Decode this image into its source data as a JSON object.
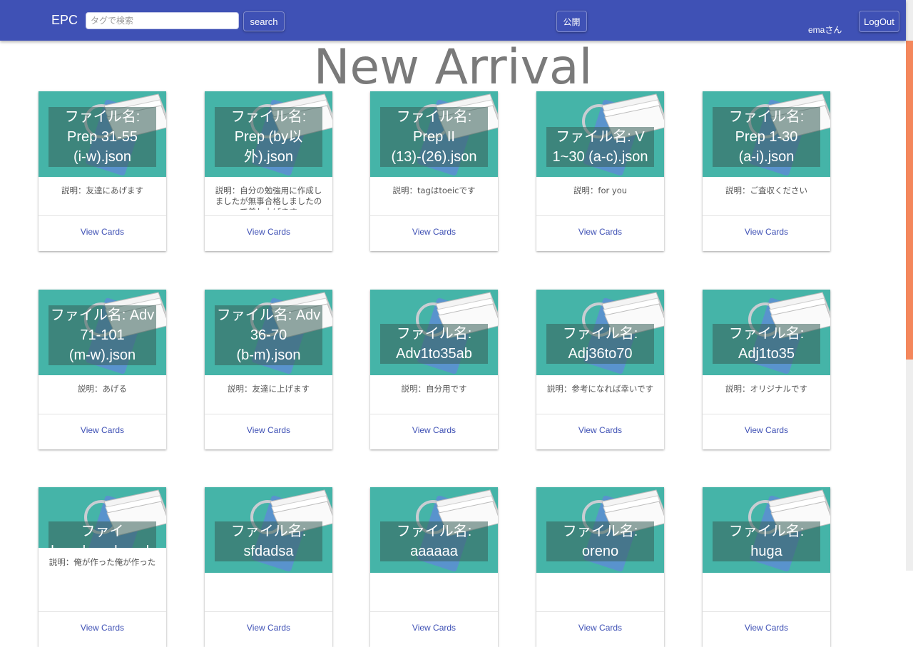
{
  "navbar": {
    "brand": "EPC",
    "search_placeholder": "タグで検索",
    "search_label": "search",
    "publish_label": "公開",
    "user_name": "emaさん",
    "logout_label": "LogOut",
    "bg_color": "#3f51b5"
  },
  "page_title": "New Arrival",
  "card_image_color": "#45b4a8",
  "card_icon": "flashcard-ring-icon",
  "cards": [
    {
      "title": [
        "ファイル名:",
        "Prep 31-55",
        "(i-w).json"
      ],
      "desc": "説明：友達にあげます",
      "action": "View Cards"
    },
    {
      "title": [
        "ファイル名:",
        "Prep (by以",
        "外).json"
      ],
      "desc": "説明：自分の勉強用に作成しましたが無事合格しましたので差し上げます",
      "action": "View Cards"
    },
    {
      "title": [
        "ファイル名:",
        "Prep II",
        "(13)-(26).json"
      ],
      "desc": "説明：tagはtoeicです",
      "action": "View Cards"
    },
    {
      "title": [
        "ファイル名: V",
        "1~30 (a-c).json"
      ],
      "desc": "説明：for you",
      "action": "View Cards"
    },
    {
      "title": [
        "ファイル名:",
        "Prep 1-30",
        "(a-i).json"
      ],
      "desc": "説明：ご査収ください",
      "action": "View Cards"
    },
    {
      "title": [
        "ファイル名: Adv",
        "71-101",
        "(m-w).json"
      ],
      "desc": "説明：あげる",
      "action": "View Cards"
    },
    {
      "title": [
        "ファイル名: Adv",
        "36-70",
        "(b-m).json"
      ],
      "desc": "説明：友達に上げます",
      "action": "View Cards"
    },
    {
      "title": [
        "ファイル名:",
        "Adv1to35ab"
      ],
      "desc": "説明：自分用です",
      "action": "View Cards"
    },
    {
      "title": [
        "ファイル名:",
        "Adj36to70"
      ],
      "desc": "説明：参考になれば幸いです",
      "action": "View Cards"
    },
    {
      "title": [
        "ファイル名:",
        "Adj1to35"
      ],
      "desc": "説明：オリジナルです",
      "action": "View Cards"
    },
    {
      "title": [
        "ファイ",
        "hogehogehogeh"
      ],
      "desc": "説明：俺が作った俺が作った",
      "action": "View Cards"
    },
    {
      "title": [
        "ファイル名:",
        "sfdadsa"
      ],
      "desc": "",
      "action": "View Cards"
    },
    {
      "title": [
        "ファイル名:",
        "aaaaaa"
      ],
      "desc": "",
      "action": "View Cards"
    },
    {
      "title": [
        "ファイル名:",
        "oreno"
      ],
      "desc": "",
      "action": "View Cards"
    },
    {
      "title": [
        "ファイル名:",
        "huga"
      ],
      "desc": "",
      "action": "View Cards"
    }
  ]
}
